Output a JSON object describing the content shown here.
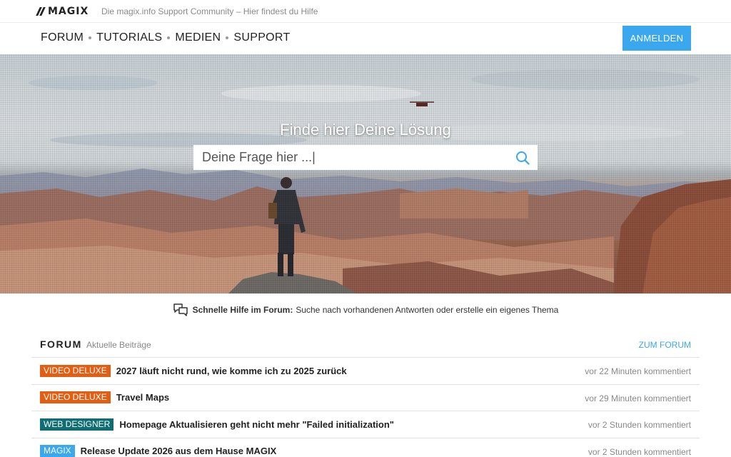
{
  "header": {
    "logo_text": "MAGIX",
    "tagline": "Die magix.info Support Community – Hier findest du Hilfe"
  },
  "nav": {
    "items": [
      "FORUM",
      "TUTORIALS",
      "MEDIEN",
      "SUPPORT"
    ],
    "login_label": "ANMELDEN"
  },
  "hero": {
    "title": "Finde hier Deine Lösung",
    "search_placeholder": "Deine Frage hier ...|"
  },
  "help": {
    "strong": "Schnelle Hilfe im Forum:",
    "text": "Suche nach vorhandenen Antworten oder erstelle ein eigenes Thema"
  },
  "forum": {
    "title": "FORUM",
    "subtitle": "Aktuelle Beiträge",
    "link": "ZUM FORUM",
    "rows": [
      {
        "tag": "VIDEO DELUXE",
        "tag_color": "#e35d12",
        "title": "2027 läuft nicht rund, wie komme ich zu 2025 zurück",
        "time": "vor 22 Minuten kommentiert"
      },
      {
        "tag": "VIDEO DELUXE",
        "tag_color": "#e35d12",
        "title": "Travel Maps",
        "time": "vor 29 Minuten kommentiert"
      },
      {
        "tag": "WEB DESIGNER",
        "tag_color": "#0f6e73",
        "title": "Homepage Aktualisieren geht nicht mehr \"Failed initialization\"",
        "time": "vor 2 Stunden kommentiert"
      },
      {
        "tag": "MAGIX",
        "tag_color": "#3aa7ee",
        "title": "Release Update 2026 aus dem Hause MAGIX",
        "time": "vor 2 Stunden kommentiert"
      }
    ]
  },
  "colors": {
    "accent": "#3aa7ee"
  }
}
